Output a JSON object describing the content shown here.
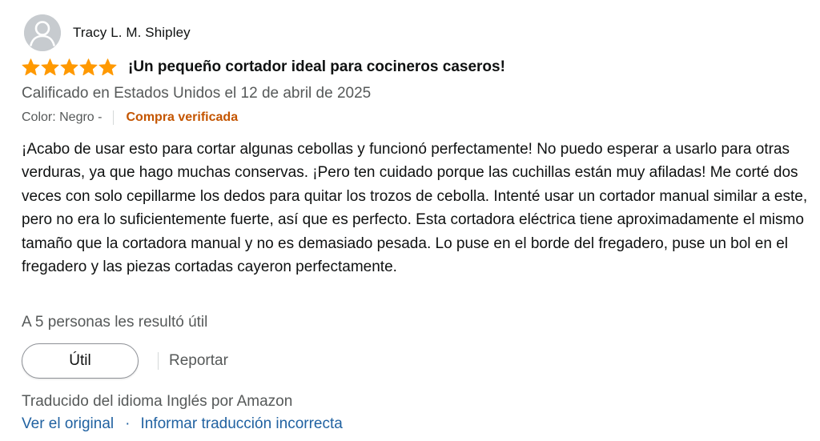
{
  "review": {
    "author": "Tracy L. M. Shipley",
    "rating": 5,
    "rating_max": 5,
    "title": "¡Un pequeño cortador ideal para cocineros caseros!",
    "date": "Calificado en Estados Unidos el 12 de abril de 2025",
    "format": "Color: Negro -",
    "verified": "Compra verificada",
    "body": "¡Acabo de usar esto para cortar algunas cebollas y funcionó perfectamente! No puedo esperar a usarlo para otras verduras, ya que hago muchas conservas. ¡Pero ten cuidado porque las cuchillas están muy afiladas! Me corté dos veces con solo cepillarme los dedos para quitar los trozos de cebolla. Intenté usar un cortador manual similar a este, pero no era lo suficientemente fuerte, así que es perfecto. Esta cortadora eléctrica tiene aproximadamente el mismo tamaño que la cortadora manual y no es demasiado pesada. Lo puse en el borde del fregadero, puse un bol en el fregadero y las piezas cortadas cayeron perfectamente.",
    "helpful_count": "A 5 personas les resultó útil"
  },
  "actions": {
    "helpful_label": "Útil",
    "report_label": "Reportar"
  },
  "translation": {
    "note": "Traducido del idioma Inglés por Amazon",
    "view_original": "Ver el original",
    "separator": "·",
    "report_translation": "Informar traducción incorrecta"
  },
  "icons": {
    "avatar": "default-user-avatar-icon",
    "star": "star-filled-icon"
  },
  "colors": {
    "star": "#ff9900",
    "verified": "#c45500",
    "link": "#2162a1",
    "secondary_text": "#565959"
  }
}
